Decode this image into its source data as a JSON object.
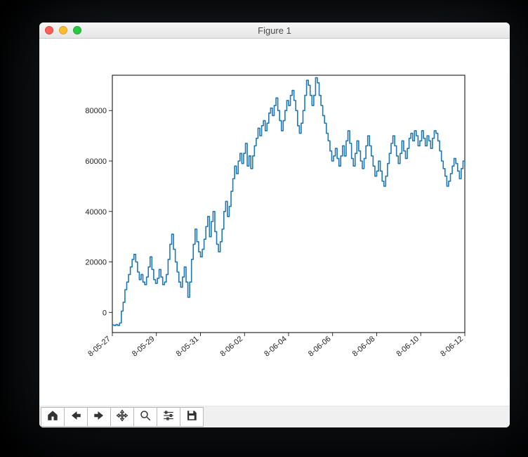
{
  "window": {
    "title": "Figure 1"
  },
  "toolbar": {
    "buttons": [
      {
        "name": "home-button",
        "icon": "home-icon"
      },
      {
        "name": "back-button",
        "icon": "arrow-left-icon"
      },
      {
        "name": "forward-button",
        "icon": "arrow-right-icon"
      },
      {
        "name": "pan-button",
        "icon": "move-icon"
      },
      {
        "name": "zoom-button",
        "icon": "zoom-icon"
      },
      {
        "name": "configure-button",
        "icon": "sliders-icon"
      },
      {
        "name": "save-button",
        "icon": "save-icon"
      }
    ]
  },
  "chart_data": {
    "type": "line",
    "xlabel": "",
    "ylabel": "",
    "title": "",
    "x_start": "2018-05-27",
    "x_end": "2018-06-12",
    "x_ticks": [
      "8-05-27",
      "8-05-29",
      "8-05-31",
      "8-06-02",
      "8-06-04",
      "8-06-06",
      "8-06-08",
      "8-06-10",
      "8-06-12"
    ],
    "y_ticks": [
      0,
      20000,
      40000,
      60000,
      80000
    ],
    "ylim": [
      -8000,
      94000
    ],
    "series": [
      {
        "name": "series-1",
        "color": "#1f77b4",
        "y": [
          -5000,
          -5200,
          -4800,
          -5200,
          -4200,
          500,
          4000,
          9000,
          12000,
          15000,
          18000,
          21000,
          23000,
          20000,
          16000,
          13000,
          15000,
          12000,
          11000,
          14000,
          18000,
          22000,
          17000,
          13000,
          11500,
          13500,
          17000,
          14000,
          11000,
          12000,
          15000,
          21000,
          27000,
          31000,
          25000,
          20000,
          16000,
          12000,
          10000,
          14000,
          18000,
          12000,
          6000,
          12000,
          21000,
          27000,
          33000,
          28000,
          24000,
          22000,
          25000,
          29000,
          34000,
          38000,
          30000,
          36000,
          40000,
          32000,
          27000,
          24000,
          28000,
          33000,
          40000,
          44000,
          38000,
          42000,
          48000,
          53000,
          58000,
          55000,
          60000,
          63000,
          59000,
          63000,
          67000,
          58000,
          62000,
          57000,
          62000,
          66000,
          69000,
          73000,
          70000,
          74000,
          76000,
          72000,
          75000,
          79000,
          81000,
          78000,
          82000,
          85000,
          80000,
          76000,
          72000,
          76000,
          80000,
          84000,
          82000,
          86000,
          88000,
          84000,
          80000,
          74000,
          71000,
          75000,
          80000,
          86000,
          92000,
          90000,
          86000,
          82000,
          86000,
          93000,
          91000,
          86000,
          82000,
          78000,
          75000,
          71000,
          68000,
          64000,
          60000,
          62000,
          65000,
          61000,
          58000,
          62000,
          66000,
          62000,
          68000,
          72000,
          67000,
          61000,
          58000,
          63000,
          68000,
          64000,
          60000,
          57000,
          61000,
          66000,
          70000,
          66000,
          62000,
          58000,
          54000,
          56000,
          60000,
          56000,
          52000,
          50000,
          54000,
          59000,
          63000,
          67000,
          70000,
          66000,
          62000,
          59000,
          63000,
          68000,
          64000,
          61000,
          65000,
          69000,
          71000,
          68000,
          72000,
          70000,
          66000,
          68000,
          72000,
          69000,
          66000,
          70000,
          68000,
          65000,
          69000,
          72000,
          71000,
          68000,
          64000,
          60000,
          57000,
          54000,
          50000,
          52000,
          55000,
          58000,
          61000,
          59000,
          56000,
          53000,
          57000,
          60000,
          58000
        ]
      }
    ]
  }
}
